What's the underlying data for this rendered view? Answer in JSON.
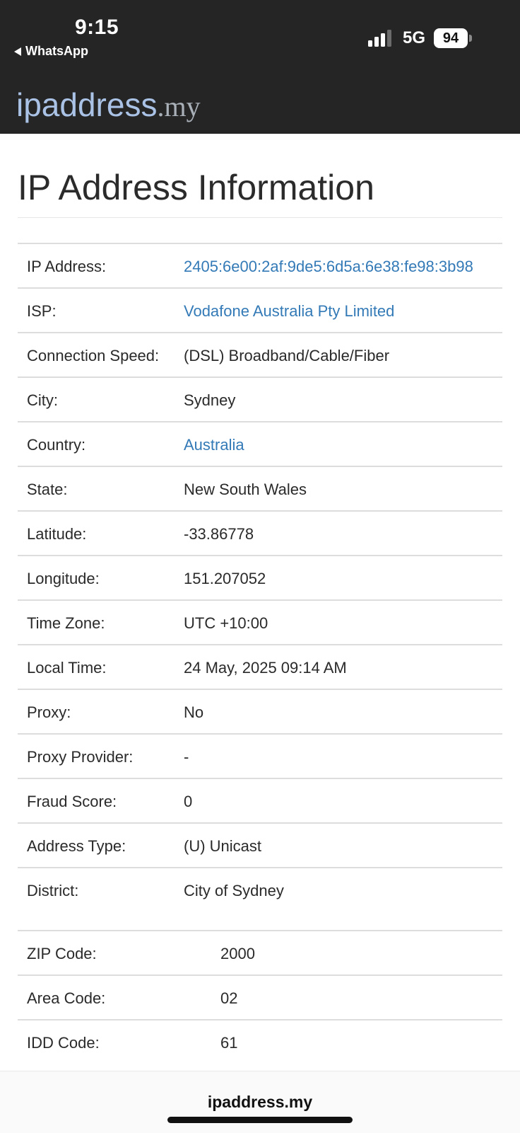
{
  "status_bar": {
    "time": "9:15",
    "back_app": "WhatsApp",
    "network": "5G",
    "battery": "94",
    "signal_bars": 3
  },
  "site": {
    "logo_main": "ipaddress",
    "logo_tld": ".my"
  },
  "page": {
    "title": "IP Address Information"
  },
  "info_rows": [
    {
      "label": "IP Address:",
      "value": "2405:6e00:2af:9de5:6d5a:6e38:fe98:3b98",
      "link": true
    },
    {
      "label": "ISP:",
      "value": "Vodafone Australia Pty Limited",
      "link": true
    },
    {
      "label": "Connection Speed:",
      "value": "(DSL) Broadband/Cable/Fiber",
      "link": false
    },
    {
      "label": "City:",
      "value": "Sydney",
      "link": false
    },
    {
      "label": "Country:",
      "value": "Australia",
      "link": true
    },
    {
      "label": "State:",
      "value": "New South Wales",
      "link": false
    },
    {
      "label": "Latitude:",
      "value": "-33.86778",
      "link": false
    },
    {
      "label": "Longitude:",
      "value": "151.207052",
      "link": false
    },
    {
      "label": "Time Zone:",
      "value": "UTC +10:00",
      "link": false
    },
    {
      "label": "Local Time:",
      "value": "24 May, 2025 09:14 AM",
      "link": false
    },
    {
      "label": "Proxy:",
      "value": "No",
      "link": false
    },
    {
      "label": "Proxy Provider:",
      "value": "-",
      "link": false
    },
    {
      "label": "Fraud Score:",
      "value": "0",
      "link": false
    },
    {
      "label": "Address Type:",
      "value": "(U) Unicast",
      "link": false
    },
    {
      "label": "District:",
      "value": "City of Sydney",
      "link": false
    }
  ],
  "info_rows_2": [
    {
      "label": "ZIP Code:",
      "value": "2000"
    },
    {
      "label": "Area Code:",
      "value": "02"
    },
    {
      "label": "IDD Code:",
      "value": "61"
    }
  ],
  "browser": {
    "url": "ipaddress.my"
  },
  "colors": {
    "header_bg": "#252525",
    "link": "#337ab7",
    "logo": "#a9c2e5"
  }
}
